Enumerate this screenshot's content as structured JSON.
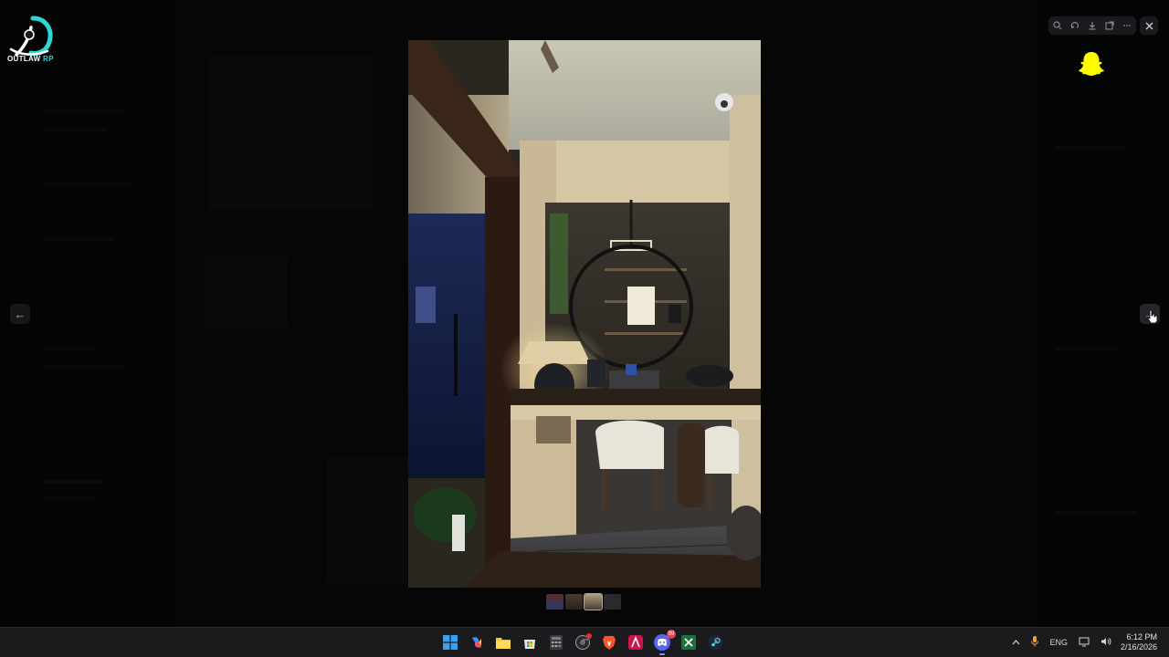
{
  "logo": {
    "brand_main": "OUTLAW",
    "brand_accent": "RP"
  },
  "viewer": {
    "toolbar_icons": [
      "zoom-icon",
      "rotate-icon",
      "download-icon",
      "open-external-icon",
      "more-icon"
    ],
    "close_icon": "close-icon",
    "prev_glyph": "←",
    "next_glyph": "→",
    "thumbnails": [
      "#5a2a2a",
      "#4a3a2c",
      "#8a7a60",
      "#2a2a2e"
    ],
    "selected_thumbnail": 2
  },
  "taskbar": {
    "apps": [
      "windows-start",
      "copilot",
      "file-explorer",
      "microsoft-store",
      "calculator",
      "chrome",
      "brave",
      "affinity",
      "discord",
      "excel",
      "steam"
    ],
    "discord_badge": "99",
    "tray": {
      "language": "ENG",
      "time": "6:12 PM",
      "date": "2/16/2026"
    }
  },
  "colors": {
    "accent": "#2fd6d6",
    "snapchat": "#fffc00",
    "discord": "#5865f2"
  }
}
